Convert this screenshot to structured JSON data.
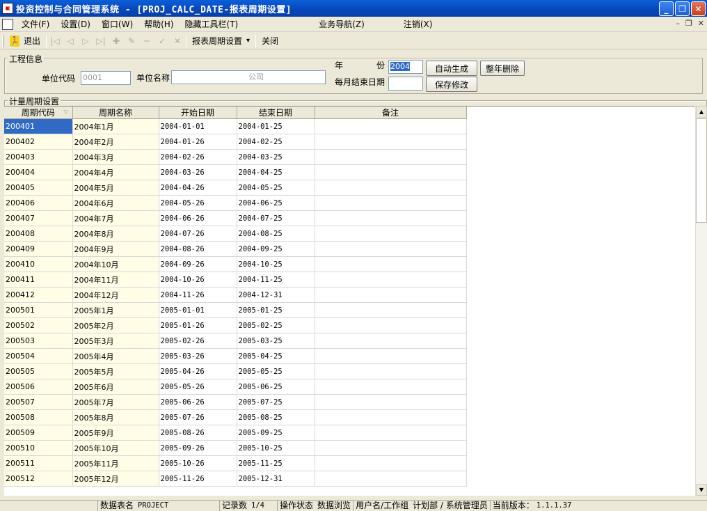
{
  "title": "投资控制与合同管理系统 - [PROJ_CALC_DATE-报表周期设置]",
  "window_buttons": {
    "minimize": "_",
    "restore": "❐",
    "close": "✕"
  },
  "menu": [
    "文件(F)",
    "设置(D)",
    "窗口(W)",
    "帮助(H)",
    "隐藏工具栏(T)",
    "业务导航(Z)",
    "注销(X)"
  ],
  "mdi_buttons": {
    "minimize": "–",
    "restore": "❐",
    "close": "✕"
  },
  "toolbar": {
    "exit_label": "退出",
    "period_settings_label": "报表周期设置",
    "dropdown_arrow": "▾",
    "close_label": "关闭"
  },
  "project_info": {
    "group_title": "工程信息",
    "unit_code_label": "单位代码",
    "unit_code_value": "0001",
    "unit_name_label": "单位名称",
    "unit_name_value": "公司",
    "year_label": "年",
    "year_label_2": "份",
    "year_value": "2004",
    "month_end_label": "每月结束日期",
    "month_end_value": "",
    "auto_generate_label": "自动生成",
    "delete_year_label": "整年删除",
    "save_label": "保存修改"
  },
  "period_settings": {
    "group_title": "计量周期设置",
    "columns": [
      "周期代码",
      "周期名称",
      "开始日期",
      "结束日期",
      "备注"
    ],
    "rows": [
      [
        "200401",
        "2004年1月",
        "2004-01-01",
        "2004-01-25",
        ""
      ],
      [
        "200402",
        "2004年2月",
        "2004-01-26",
        "2004-02-25",
        ""
      ],
      [
        "200403",
        "2004年3月",
        "2004-02-26",
        "2004-03-25",
        ""
      ],
      [
        "200404",
        "2004年4月",
        "2004-03-26",
        "2004-04-25",
        ""
      ],
      [
        "200405",
        "2004年5月",
        "2004-04-26",
        "2004-05-25",
        ""
      ],
      [
        "200406",
        "2004年6月",
        "2004-05-26",
        "2004-06-25",
        ""
      ],
      [
        "200407",
        "2004年7月",
        "2004-06-26",
        "2004-07-25",
        ""
      ],
      [
        "200408",
        "2004年8月",
        "2004-07-26",
        "2004-08-25",
        ""
      ],
      [
        "200409",
        "2004年9月",
        "2004-08-26",
        "2004-09-25",
        ""
      ],
      [
        "200410",
        "2004年10月",
        "2004-09-26",
        "2004-10-25",
        ""
      ],
      [
        "200411",
        "2004年11月",
        "2004-10-26",
        "2004-11-25",
        ""
      ],
      [
        "200412",
        "2004年12月",
        "2004-11-26",
        "2004-12-31",
        ""
      ],
      [
        "200501",
        "2005年1月",
        "2005-01-01",
        "2005-01-25",
        ""
      ],
      [
        "200502",
        "2005年2月",
        "2005-01-26",
        "2005-02-25",
        ""
      ],
      [
        "200503",
        "2005年3月",
        "2005-02-26",
        "2005-03-25",
        ""
      ],
      [
        "200504",
        "2005年4月",
        "2005-03-26",
        "2005-04-25",
        ""
      ],
      [
        "200505",
        "2005年5月",
        "2005-04-26",
        "2005-05-25",
        ""
      ],
      [
        "200506",
        "2005年6月",
        "2005-05-26",
        "2005-06-25",
        ""
      ],
      [
        "200507",
        "2005年7月",
        "2005-06-26",
        "2005-07-25",
        ""
      ],
      [
        "200508",
        "2005年8月",
        "2005-07-26",
        "2005-08-25",
        ""
      ],
      [
        "200509",
        "2005年9月",
        "2005-08-26",
        "2005-09-25",
        ""
      ],
      [
        "200510",
        "2005年10月",
        "2005-09-26",
        "2005-10-25",
        ""
      ],
      [
        "200511",
        "2005年11月",
        "2005-10-26",
        "2005-11-25",
        ""
      ],
      [
        "200512",
        "2005年12月",
        "2005-11-26",
        "2005-12-31",
        ""
      ]
    ]
  },
  "status": {
    "table_label": "数据表名",
    "table_value": "PROJECT",
    "records_label": "记录数",
    "records_value": "1/4",
    "op_label": "操作状态",
    "op_value": "数据浏览",
    "user_label": "用户名/工作组",
    "user_value": "计划部 / 系统管理员",
    "version_label": "当前版本：",
    "version_value": "1.1.1.37"
  }
}
